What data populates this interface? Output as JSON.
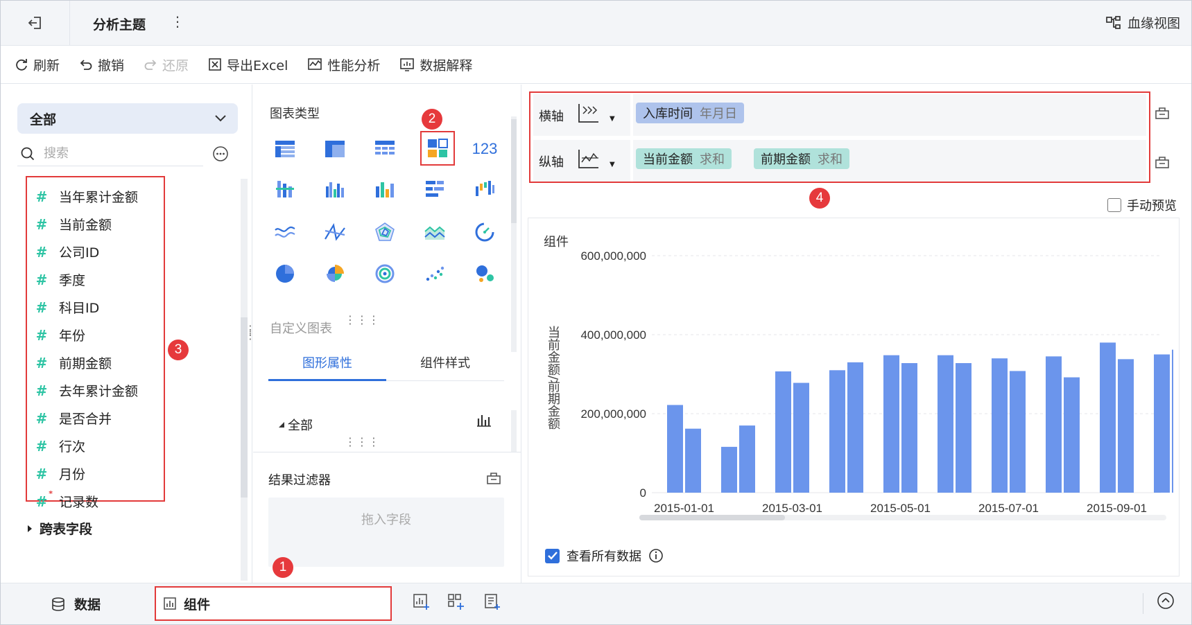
{
  "header": {
    "title": "分析主题",
    "lineage_label": "血缘视图"
  },
  "toolbar": {
    "refresh": "刷新",
    "undo": "撤销",
    "redo": "还原",
    "export": "导出Excel",
    "perf": "性能分析",
    "explain": "数据解释"
  },
  "data_panel": {
    "scope": "全部",
    "search_placeholder": "搜索",
    "fields": [
      "当年累计金额",
      "当前金额",
      "公司ID",
      "季度",
      "科目ID",
      "年份",
      "前期金额",
      "去年累计金额",
      "是否合并",
      "行次",
      "月份",
      "记录数"
    ],
    "cross_table": "跨表字段"
  },
  "mid_panel": {
    "chart_type_title": "图表类型",
    "chart_types_selected": "custom-combo",
    "custom_chart": "自定义图表",
    "tab_attr": "图形属性",
    "tab_style": "组件样式",
    "attr_all": "全部",
    "filter_title": "结果过滤器",
    "drop_hint": "拖入字段"
  },
  "axes": {
    "x_label": "横轴",
    "y_label": "纵轴",
    "x_field": {
      "name": "入库时间",
      "agg": "年月日"
    },
    "y_fields": [
      {
        "name": "当前金额",
        "agg": "求和"
      },
      {
        "name": "前期金额",
        "agg": "求和"
      }
    ]
  },
  "preview": {
    "manual_preview": "手动预览",
    "component_name": "组件",
    "view_all": "查看所有数据"
  },
  "badges": [
    "1",
    "2",
    "3",
    "4"
  ],
  "bottom": {
    "data_tab": "数据",
    "component_tab": "组件"
  },
  "colors": {
    "accent": "#2f6fdb",
    "bar": "#6b95ec",
    "badge": "#e6393c",
    "dimension_chip": "#aec3ec",
    "measure_chip": "#b0e2db"
  },
  "chart_data": {
    "type": "bar",
    "title": "",
    "xlabel": "",
    "ylabel": "当前金额/前期金额",
    "ylim": [
      0,
      600000000
    ],
    "yticks": [
      "600,000,000",
      "400,000,000",
      "200,000,000",
      "0"
    ],
    "xtick_labels": [
      "2015-01-01",
      "2015-03-01",
      "2015-05-01",
      "2015-07-01",
      "2015-09-01"
    ],
    "x": [
      "2015-01-01",
      "2015-02-01",
      "2015-03-01",
      "2015-04-01",
      "2015-05-01",
      "2015-06-01",
      "2015-07-01",
      "2015-08-01",
      "2015-09-01",
      "2015-10-01"
    ],
    "series": [
      {
        "name": "当前金额",
        "values": [
          222000000,
          116000000,
          307000000,
          310000000,
          348000000,
          348000000,
          340000000,
          345000000,
          380000000,
          350000000
        ]
      },
      {
        "name": "前期金额",
        "values": [
          162000000,
          170000000,
          278000000,
          330000000,
          328000000,
          328000000,
          308000000,
          292000000,
          338000000,
          362000000
        ]
      }
    ]
  }
}
